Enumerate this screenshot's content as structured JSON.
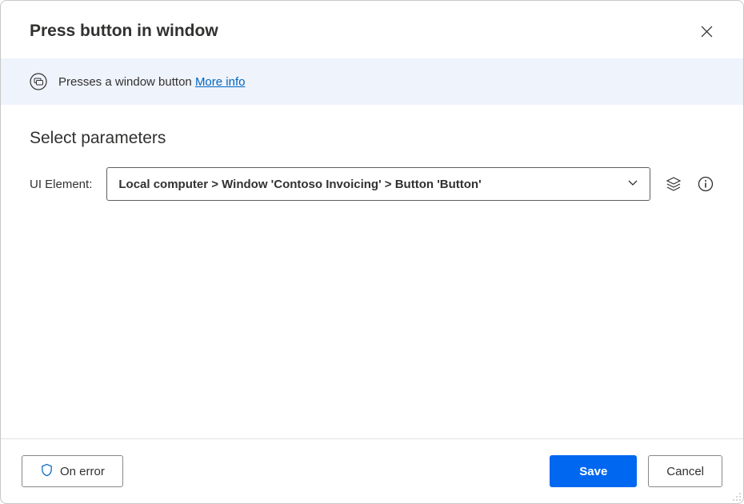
{
  "dialog": {
    "title": "Press button in window"
  },
  "info": {
    "description": "Presses a window button",
    "more_info_label": "More info"
  },
  "params": {
    "heading": "Select parameters",
    "ui_element_label": "UI Element:",
    "ui_element_value": "Local computer > Window 'Contoso Invoicing' > Button 'Button'"
  },
  "footer": {
    "on_error_label": "On error",
    "save_label": "Save",
    "cancel_label": "Cancel"
  }
}
